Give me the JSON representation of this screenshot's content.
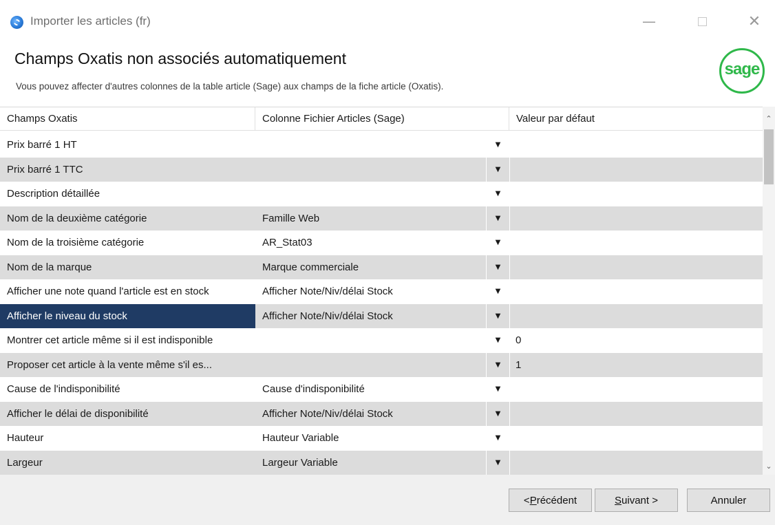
{
  "window": {
    "title": "Importer les articles (fr)",
    "minimize_glyph": "—",
    "close_glyph": "✕"
  },
  "header": {
    "title": "Champs Oxatis non associés automatiquement",
    "subtitle": "Vous pouvez affecter d'autres colonnes de la table article (Sage) aux champs de la fiche article (Oxatis).",
    "logo_text": "sage"
  },
  "grid": {
    "columns": [
      "Champs Oxatis",
      "Colonne Fichier Articles (Sage)",
      "Valeur par défaut"
    ],
    "dropdown_glyph": "▼",
    "rows": [
      {
        "field": "Prix barré 1 HT",
        "column": "",
        "default": ""
      },
      {
        "field": "Prix barré 1 TTC",
        "column": "",
        "default": ""
      },
      {
        "field": "Description détaillée",
        "column": "",
        "default": ""
      },
      {
        "field": "Nom de la deuxième catégorie",
        "column": "Famille Web",
        "default": ""
      },
      {
        "field": "Nom de la troisième catégorie",
        "column": "AR_Stat03",
        "default": ""
      },
      {
        "field": "Nom de la marque",
        "column": "Marque commerciale",
        "default": ""
      },
      {
        "field": "Afficher une note quand l'article est en stock",
        "column": "Afficher Note/Niv/délai Stock",
        "default": ""
      },
      {
        "field": "Afficher le niveau du stock",
        "column": "Afficher Note/Niv/délai Stock",
        "default": "",
        "selected": true
      },
      {
        "field": "Montrer cet article même si il est indisponible",
        "column": "",
        "default": "0"
      },
      {
        "field": "Proposer cet article à la vente même s'il es...",
        "column": "",
        "default": "1"
      },
      {
        "field": "Cause de l'indisponibilité",
        "column": "Cause d'indisponibilité",
        "default": ""
      },
      {
        "field": "Afficher le délai de disponibilité",
        "column": "Afficher Note/Niv/délai Stock",
        "default": ""
      },
      {
        "field": "Hauteur",
        "column": "Hauteur Variable",
        "default": ""
      },
      {
        "field": "Largeur",
        "column": "Largeur Variable",
        "default": ""
      }
    ]
  },
  "scrollbar": {
    "up_glyph": "⌃",
    "down_glyph": "⌄"
  },
  "footer": {
    "prev_prefix": "< ",
    "prev_mnemonic": "P",
    "prev_rest": "récédent",
    "next_mnemonic": "S",
    "next_rest": "uivant >",
    "cancel_label": "Annuler"
  },
  "colors": {
    "selected_row": "#1f3b64",
    "alt_row": "#dcdcdc",
    "logo_green": "#2fb84a"
  }
}
